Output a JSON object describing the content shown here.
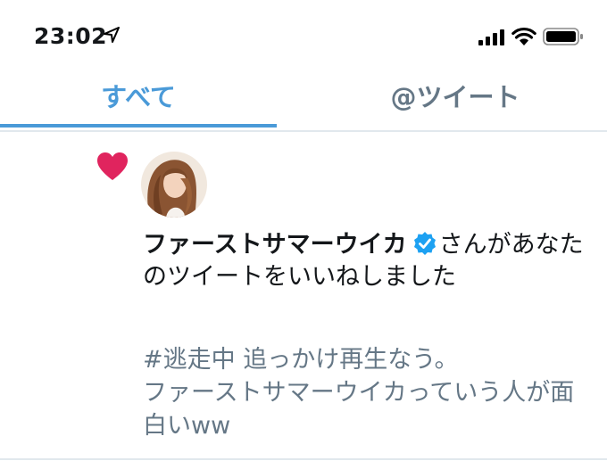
{
  "status_bar": {
    "time": "23:02",
    "icons": [
      "location-arrow-icon",
      "signal-icon",
      "wifi-icon",
      "battery-icon"
    ]
  },
  "tabs": [
    {
      "label": "すべて",
      "active": true
    },
    {
      "label": "@ツイート",
      "active": false
    }
  ],
  "colors": {
    "accent": "#4a9ad8",
    "heart": "#e0245e",
    "muted": "#657786",
    "verified": "#1da1f2"
  },
  "notification": {
    "icon": "heart-icon",
    "user_name": "ファーストサマーウイカ",
    "verified": true,
    "action_suffix": "さんがあなたのツイートをいいねしました",
    "tweet_line1": "#逃走中 追っかけ再生なう。",
    "tweet_line2": "ファーストサマーウイカっていう人が面白いww"
  }
}
